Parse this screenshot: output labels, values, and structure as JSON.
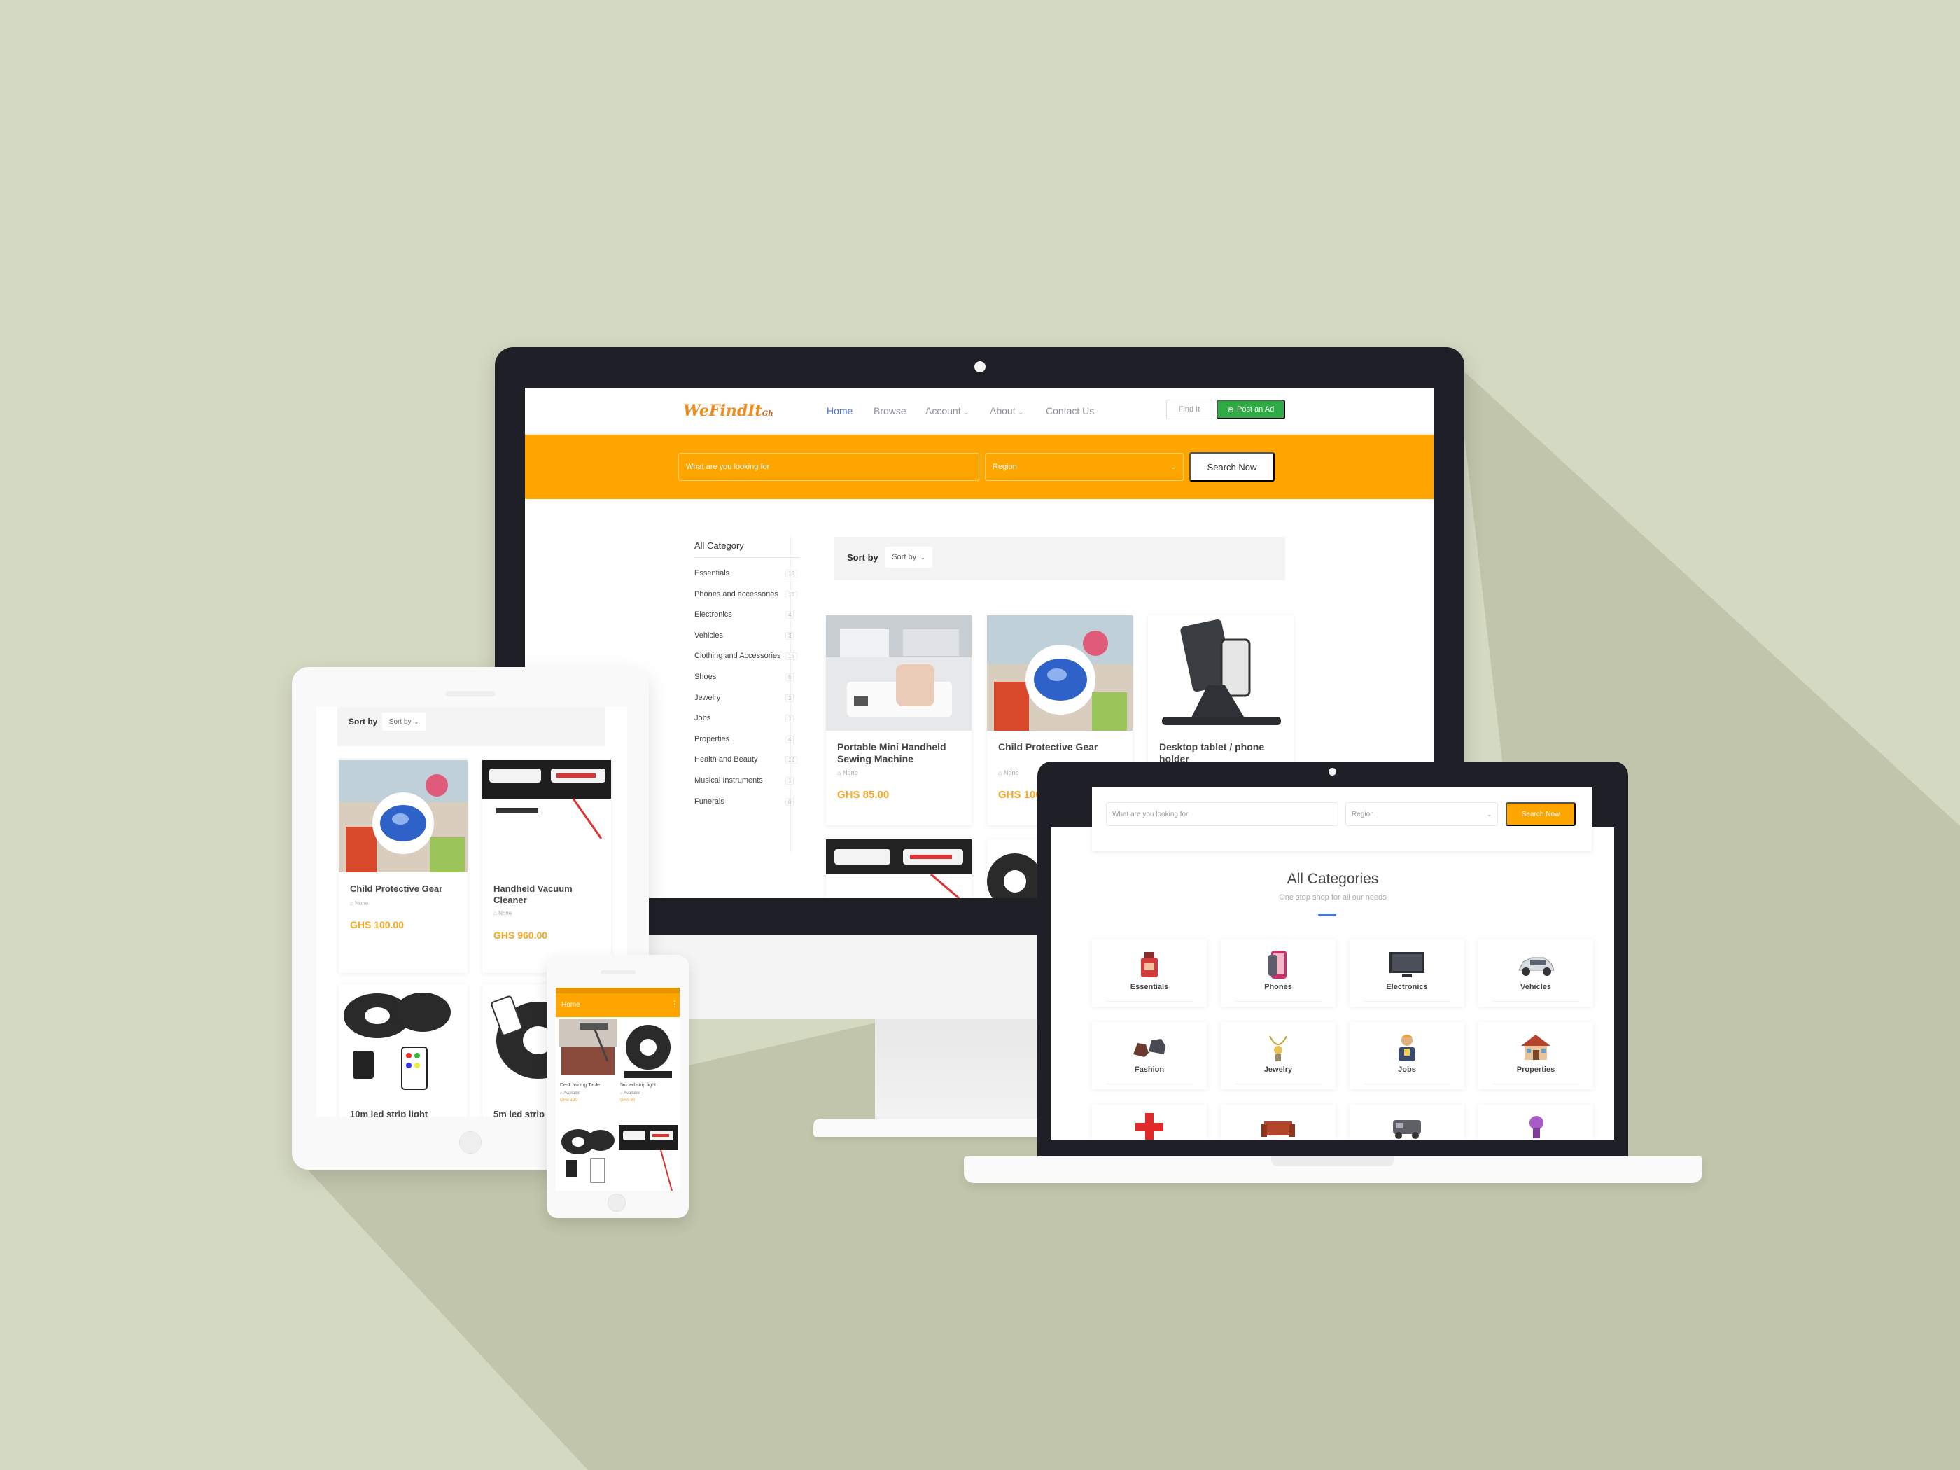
{
  "monitor": {
    "logo": {
      "main": "WeFindIt",
      "suffix": "Gh"
    },
    "nav": [
      {
        "label": "Home",
        "active": true
      },
      {
        "label": "Browse"
      },
      {
        "label": "Account",
        "dropdown": true
      },
      {
        "label": "About",
        "dropdown": true
      },
      {
        "label": "Contact Us"
      }
    ],
    "find_button": "Find It",
    "post_button": "Post an Ad",
    "search": {
      "placeholder": "What are you looking for",
      "region": "Region",
      "button": "Search Now"
    },
    "sidebar": {
      "title": "All Category",
      "items": [
        {
          "label": "Essentials",
          "count": "18"
        },
        {
          "label": "Phones and accessories",
          "count": "10"
        },
        {
          "label": "Electronics",
          "count": "4"
        },
        {
          "label": "Vehicles",
          "count": "3"
        },
        {
          "label": "Clothing and Accessories",
          "count": "15"
        },
        {
          "label": "Shoes",
          "count": "6"
        },
        {
          "label": "Jewelry",
          "count": "2"
        },
        {
          "label": "Jobs",
          "count": "1"
        },
        {
          "label": "Properties",
          "count": "4"
        },
        {
          "label": "Health and Beauty",
          "count": "12"
        },
        {
          "label": "Musical Instruments",
          "count": "1"
        },
        {
          "label": "Funerals",
          "count": "0"
        }
      ]
    },
    "sort": {
      "label": "Sort by",
      "value": "Sort by"
    },
    "products": [
      {
        "title": "Portable Mini Handheld Sewing Machine",
        "condition": "None",
        "price": "GHS 85.00"
      },
      {
        "title": "Child Protective Gear",
        "condition": "None",
        "price": "GHS 100.00"
      },
      {
        "title": "Desktop tablet / phone holder",
        "condition": "None",
        "price": ""
      }
    ]
  },
  "tablet": {
    "sort": {
      "label": "Sort by",
      "value": "Sort by"
    },
    "products": [
      {
        "title": "Child Protective Gear",
        "condition": "None",
        "price": "GHS 100.00"
      },
      {
        "title": "Handheld Vacuum Cleaner",
        "condition": "None",
        "price": "GHS 960.00"
      },
      {
        "title": "10m led strip light"
      },
      {
        "title": "5m led strip"
      }
    ]
  },
  "phone": {
    "header": "Home",
    "products": [
      {
        "title": "Desk folding Table...",
        "condition": "Available",
        "price": "GHS 190"
      },
      {
        "title": "5m led strip light",
        "condition": "Available",
        "price": "GHS 90"
      }
    ]
  },
  "laptop": {
    "search": {
      "placeholder": "What are you looking for",
      "region": "Region",
      "button": "Search Now"
    },
    "title": "All Categories",
    "subtitle": "One stop shop for all our needs",
    "categories": [
      {
        "label": "Essentials",
        "icon": "perfume-icon"
      },
      {
        "label": "Phones",
        "icon": "phone-icon"
      },
      {
        "label": "Electronics",
        "icon": "tv-icon"
      },
      {
        "label": "Vehicles",
        "icon": "car-icon"
      },
      {
        "label": "Fashion",
        "icon": "shoes-icon"
      },
      {
        "label": "Jewelry",
        "icon": "necklace-icon"
      },
      {
        "label": "Jobs",
        "icon": "worker-icon"
      },
      {
        "label": "Properties",
        "icon": "house-icon"
      }
    ]
  }
}
